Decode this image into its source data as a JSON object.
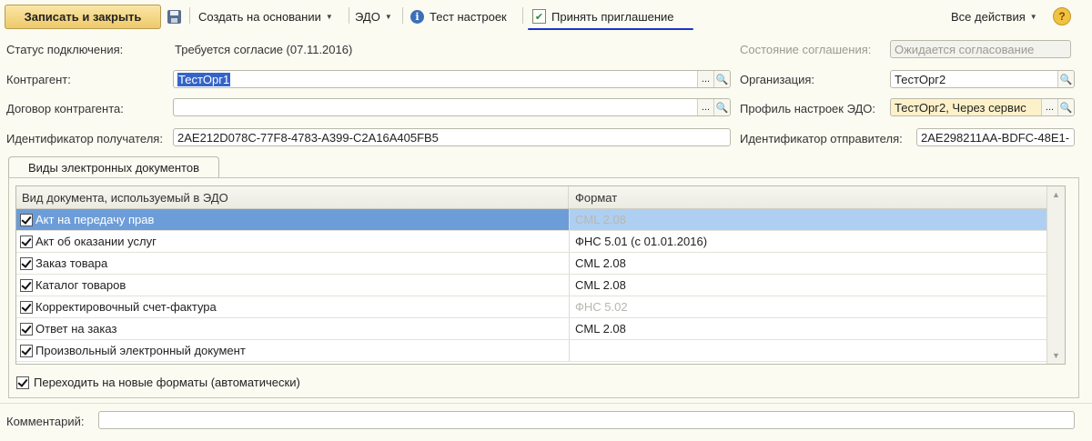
{
  "toolbar": {
    "save_close": "Записать и закрыть",
    "create_based": "Создать на основании",
    "edo": "ЭДО",
    "test_settings": "Тест настроек",
    "accept_invite": "Принять приглашение",
    "all_actions": "Все действия",
    "help": "?"
  },
  "form": {
    "status_label": "Статус подключения:",
    "status_value": "Требуется согласие (07.11.2016)",
    "agreement_state_label": "Состояние соглашения:",
    "agreement_state_value": "Ожидается согласование",
    "counterparty_label": "Контрагент:",
    "counterparty_value": "ТестОрг1",
    "organization_label": "Организация:",
    "organization_value": "ТестОрг2",
    "contract_label": "Договор контрагента:",
    "contract_value": "",
    "profile_label": "Профиль настроек ЭДО:",
    "profile_value": "ТестОрг2, Через сервис",
    "receiver_id_label": "Идентификатор получателя:",
    "receiver_id_value": "2AE212D078C-77F8-4783-A399-C2A16A405FB5",
    "sender_id_label": "Идентификатор отправителя:",
    "sender_id_value": "2AE298211AA-BDFC-48E1-",
    "ellipsis": "...",
    "search": "🔍"
  },
  "tab": {
    "label": "Виды электронных документов"
  },
  "table": {
    "columns": [
      "Вид документа, используемый в ЭДО",
      "Формат"
    ],
    "rows": [
      {
        "name": "Акт на передачу прав",
        "format": "CML 2.08",
        "checked": true,
        "format_greyed": true,
        "selected": true
      },
      {
        "name": "Акт об оказании услуг",
        "format": "ФНС 5.01 (с 01.01.2016)",
        "checked": true,
        "format_greyed": false
      },
      {
        "name": "Заказ товара",
        "format": "CML 2.08",
        "checked": true,
        "format_greyed": false
      },
      {
        "name": "Каталог товаров",
        "format": "CML 2.08",
        "checked": true,
        "format_greyed": false
      },
      {
        "name": "Корректировочный счет-фактура",
        "format": "ФНС 5.02",
        "checked": true,
        "format_greyed": true
      },
      {
        "name": "Ответ на заказ",
        "format": "CML 2.08",
        "checked": true,
        "format_greyed": false
      },
      {
        "name": "Произвольный электронный документ",
        "format": "",
        "checked": true,
        "format_greyed": false
      }
    ]
  },
  "auto_formats_label": "Переходить на новые форматы (автоматически)",
  "comment_label": "Комментарий:",
  "comment_value": "",
  "colors": {
    "accent": "#eec96a",
    "selection": "#aecff1",
    "underline": "#1d34c8"
  }
}
